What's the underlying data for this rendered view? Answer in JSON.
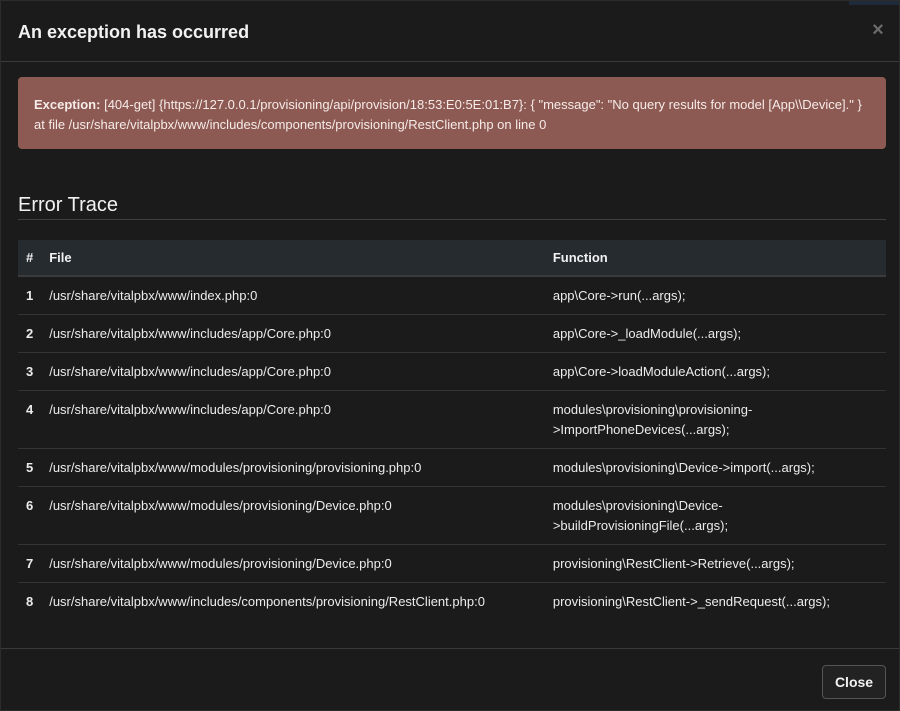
{
  "modal": {
    "title": "An exception has occurred",
    "close_glyph": "×"
  },
  "alert": {
    "label": "Exception:",
    "message": "[404-get] {https://127.0.0.1/provisioning/api/provision/18:53:E0:5E:01:B7}: { \"message\": \"No query results for model [App\\\\Device].\" } at file /usr/share/vitalpbx/www/includes/components/provisioning/RestClient.php on line 0",
    "color": "#8c5a52"
  },
  "trace": {
    "title": "Error Trace",
    "headers": {
      "num": "#",
      "file": "File",
      "function": "Function"
    },
    "rows": [
      {
        "num": "1",
        "file": "/usr/share/vitalpbx/www/index.php:0",
        "function": "app\\Core->run(...args);"
      },
      {
        "num": "2",
        "file": "/usr/share/vitalpbx/www/includes/app/Core.php:0",
        "function": "app\\Core->_loadModule(...args);"
      },
      {
        "num": "3",
        "file": "/usr/share/vitalpbx/www/includes/app/Core.php:0",
        "function": "app\\Core->loadModuleAction(...args);"
      },
      {
        "num": "4",
        "file": "/usr/share/vitalpbx/www/includes/app/Core.php:0",
        "function": "modules\\provisioning\\provisioning->ImportPhoneDevices(...args);"
      },
      {
        "num": "5",
        "file": "/usr/share/vitalpbx/www/modules/provisioning/provisioning.php:0",
        "function": "modules\\provisioning\\Device->import(...args);"
      },
      {
        "num": "6",
        "file": "/usr/share/vitalpbx/www/modules/provisioning/Device.php:0",
        "function": "modules\\provisioning\\Device->buildProvisioningFile(...args);"
      },
      {
        "num": "7",
        "file": "/usr/share/vitalpbx/www/modules/provisioning/Device.php:0",
        "function": "provisioning\\RestClient->Retrieve(...args);"
      },
      {
        "num": "8",
        "file": "/usr/share/vitalpbx/www/includes/components/provisioning/RestClient.php:0",
        "function": "provisioning\\RestClient->_sendRequest(...args);"
      }
    ]
  },
  "footer": {
    "close_label": "Close"
  },
  "colors": {
    "background": "#1b1b1b",
    "table_header": "#262b30"
  }
}
